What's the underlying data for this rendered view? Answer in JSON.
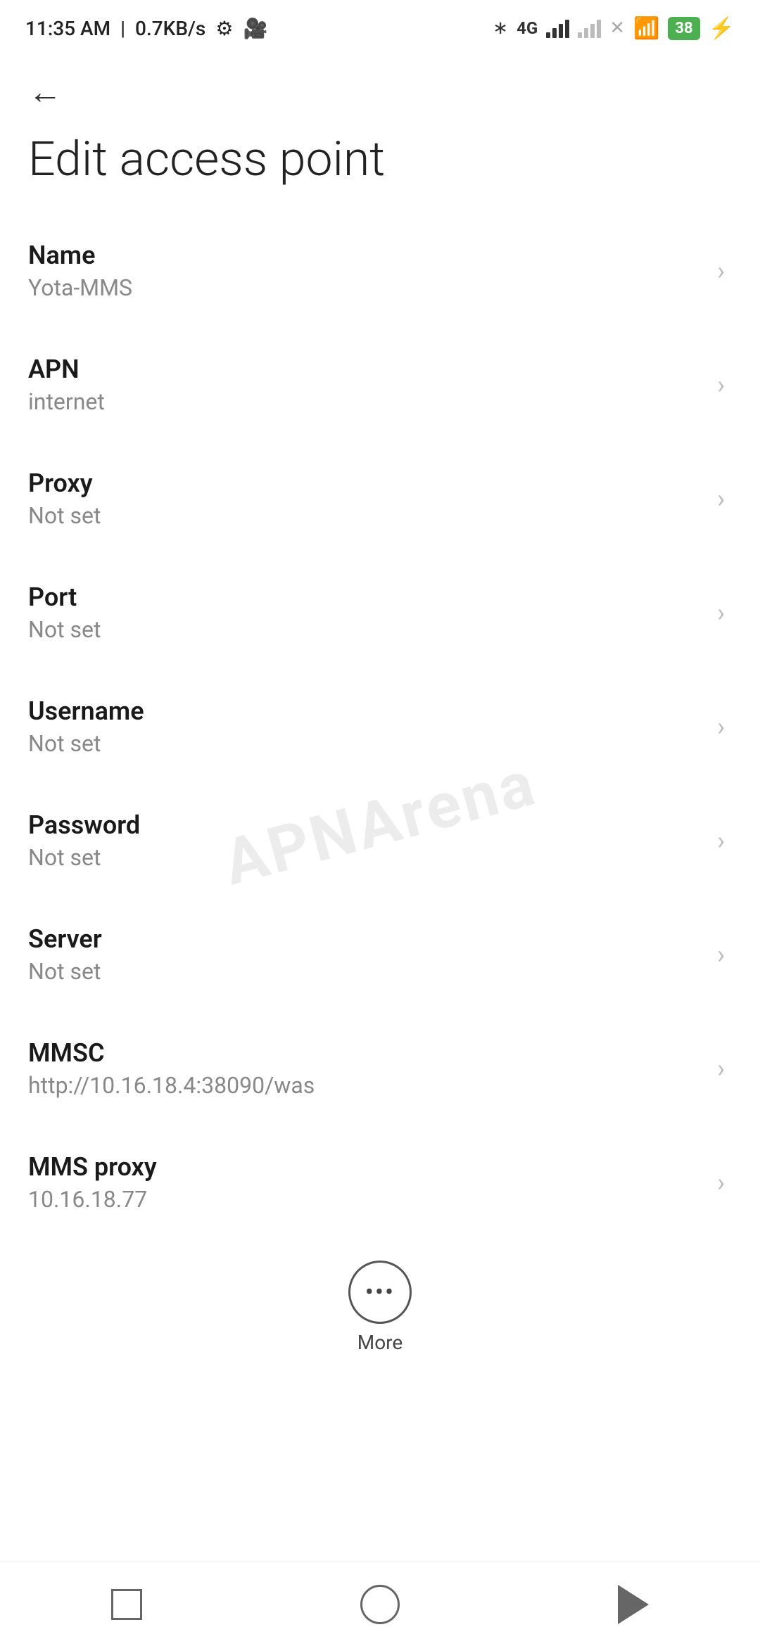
{
  "statusBar": {
    "time": "11:35 AM",
    "network_speed": "0.7KB/s",
    "battery_level": "38"
  },
  "page": {
    "title": "Edit access point",
    "back_label": "←"
  },
  "settings": [
    {
      "id": "name",
      "label": "Name",
      "value": "Yota-MMS"
    },
    {
      "id": "apn",
      "label": "APN",
      "value": "internet"
    },
    {
      "id": "proxy",
      "label": "Proxy",
      "value": "Not set"
    },
    {
      "id": "port",
      "label": "Port",
      "value": "Not set"
    },
    {
      "id": "username",
      "label": "Username",
      "value": "Not set"
    },
    {
      "id": "password",
      "label": "Password",
      "value": "Not set"
    },
    {
      "id": "server",
      "label": "Server",
      "value": "Not set"
    },
    {
      "id": "mmsc",
      "label": "MMSC",
      "value": "http://10.16.18.4:38090/was"
    },
    {
      "id": "mms-proxy",
      "label": "MMS proxy",
      "value": "10.16.18.77"
    }
  ],
  "more": {
    "label": "More"
  },
  "bottomNav": {
    "square_label": "recent",
    "circle_label": "home",
    "triangle_label": "back"
  },
  "watermark": {
    "line1": "APNArena"
  }
}
